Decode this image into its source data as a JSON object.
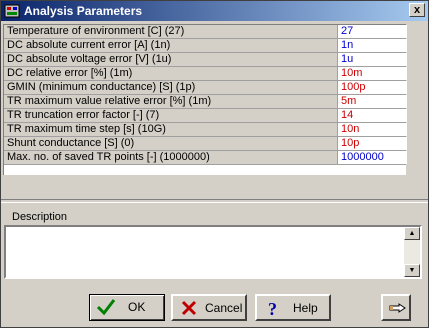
{
  "window": {
    "title": "Analysis Parameters",
    "close_label": "x"
  },
  "parameters": [
    {
      "name": "Temperature of environment [C]  (27)",
      "value": "27",
      "color": "#0000cc"
    },
    {
      "name": "DC absolute current error [A]  (1n)",
      "value": "1n",
      "color": "#0000cc"
    },
    {
      "name": "DC absolute voltage error [V]  (1u)",
      "value": "1u",
      "color": "#0000cc"
    },
    {
      "name": "DC relative error [%]  (1m)",
      "value": "10m",
      "color": "#cc0000"
    },
    {
      "name": "GMIN (minimum conductance) [S]  (1p)",
      "value": "100p",
      "color": "#cc0000"
    },
    {
      "name": "TR maximum value relative error [%]  (1m)",
      "value": "5m",
      "color": "#cc0000"
    },
    {
      "name": "TR truncation error factor [-]  (7)",
      "value": "14",
      "color": "#cc0000"
    },
    {
      "name": "TR maximum time step [s]  (10G)",
      "value": "10n",
      "color": "#cc0000"
    },
    {
      "name": "Shunt conductance [S]  (0)",
      "value": "10p",
      "color": "#cc0000"
    },
    {
      "name": "Max. no. of saved TR points [-]  (1000000)",
      "value": "1000000",
      "color": "#0000cc"
    }
  ],
  "description": {
    "label": "Description",
    "text": ""
  },
  "buttons": {
    "ok": "OK",
    "cancel": "Cancel",
    "help": "Help"
  },
  "icons": {
    "title": "app-icon",
    "ok": "checkmark-icon",
    "cancel": "x-icon",
    "help": "question-icon",
    "pointer": "hand-pointer-icon"
  }
}
